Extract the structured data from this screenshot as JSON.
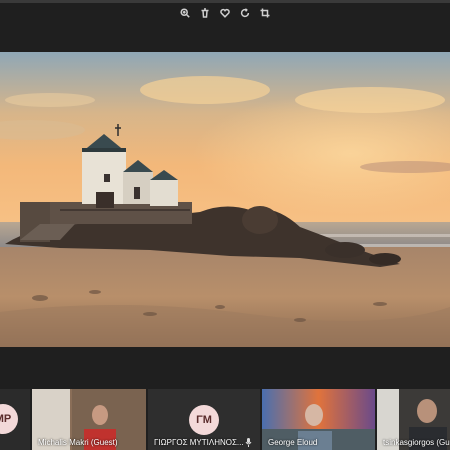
{
  "toolbar": {
    "tools": [
      {
        "icon": "zoom-icon"
      },
      {
        "icon": "trash-icon"
      },
      {
        "icon": "heart-icon"
      },
      {
        "icon": "rotate-icon"
      },
      {
        "icon": "crop-icon"
      }
    ]
  },
  "shared_content": {
    "type": "photo",
    "subject": "chapel-on-rocky-beach-at-sunset"
  },
  "participants": [
    {
      "name": "",
      "initials": "MP"
    },
    {
      "name": "Michalis Makri (Guest)",
      "initials": ""
    },
    {
      "name": "ΓΙΩΡΓΟΣ ΜΥΤΙΛΗΝΟΣ...",
      "initials": "ΓΜ"
    },
    {
      "name": "George Eloud",
      "initials": ""
    },
    {
      "name": "tsinkasgiorgos (Gue",
      "initials": ""
    }
  ],
  "colors": {
    "background": "#1f1f1f",
    "tile_bg": "#2d2d2d",
    "avatar_bg": "#f3d9d9"
  }
}
